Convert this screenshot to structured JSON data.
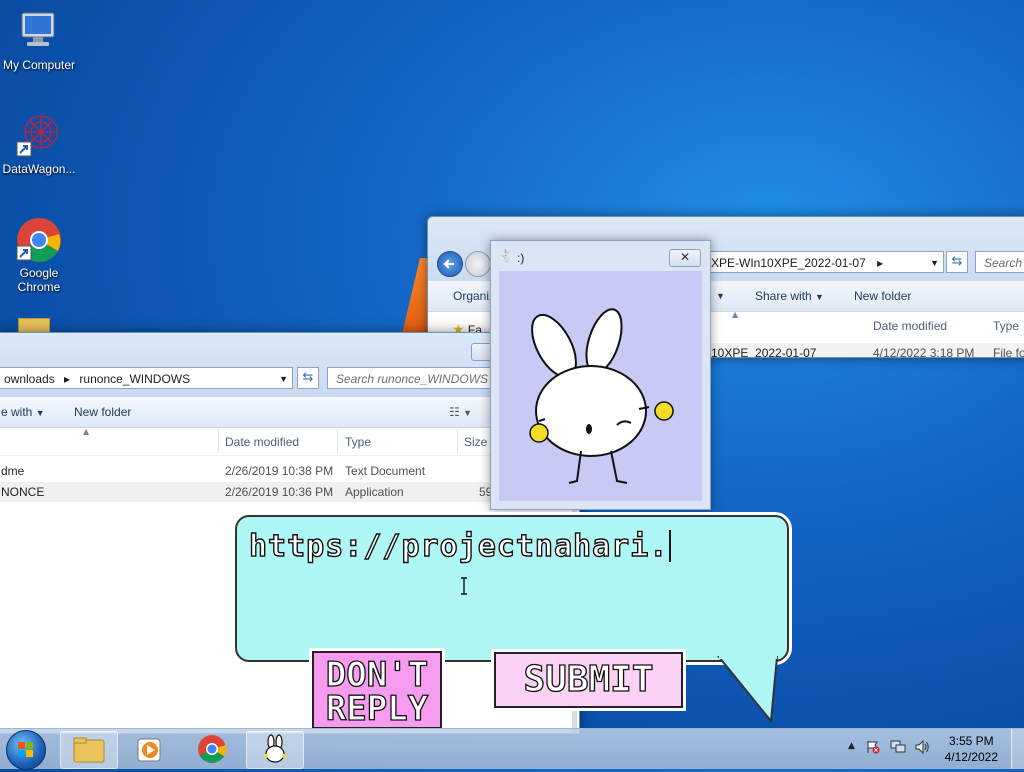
{
  "desktop": {
    "icons": [
      {
        "label": "My Computer"
      },
      {
        "label": "DataWagon..."
      },
      {
        "label": "Google Chrome"
      }
    ]
  },
  "back_window": {
    "address": "XPE-WIn10XPE_2022-01-07",
    "search_placeholder": "Search ",
    "toolbar": {
      "organize": "Organiz",
      "share_with": "Share with",
      "new_folder": "New folder"
    },
    "columns": {
      "date_modified": "Date modified",
      "type": "Type"
    },
    "favorites": "Fa",
    "row": {
      "name": "10XPE_2022-01-07",
      "date": "4/12/2022 3:18 PM",
      "type": "File fo"
    }
  },
  "front_window": {
    "breadcrumb": {
      "part1": "ownloads",
      "part2": "runonce_WINDOWS"
    },
    "search_placeholder": "Search runonce_WINDOWS",
    "toolbar": {
      "share_with": "e with",
      "new_folder": "New folder"
    },
    "columns": {
      "date_modified": "Date modified",
      "type": "Type",
      "size": "Size"
    },
    "rows": [
      {
        "name": "dme",
        "date": "2/26/2019 10:38 PM",
        "type": "Text Document",
        "size": ""
      },
      {
        "name": "NONCE",
        "date": "2/26/2019 10:36 PM",
        "type": "Application",
        "size": "59"
      }
    ]
  },
  "popup": {
    "title": ":)",
    "close_glyph": "✕"
  },
  "nahari": {
    "input_text": "https://projectnahari.",
    "dont_reply_line1": "DON'T",
    "dont_reply_line2": "REPLY",
    "submit": "SUBMIT"
  },
  "taskbar": {
    "time": "3:55 PM",
    "date": "4/12/2022"
  }
}
